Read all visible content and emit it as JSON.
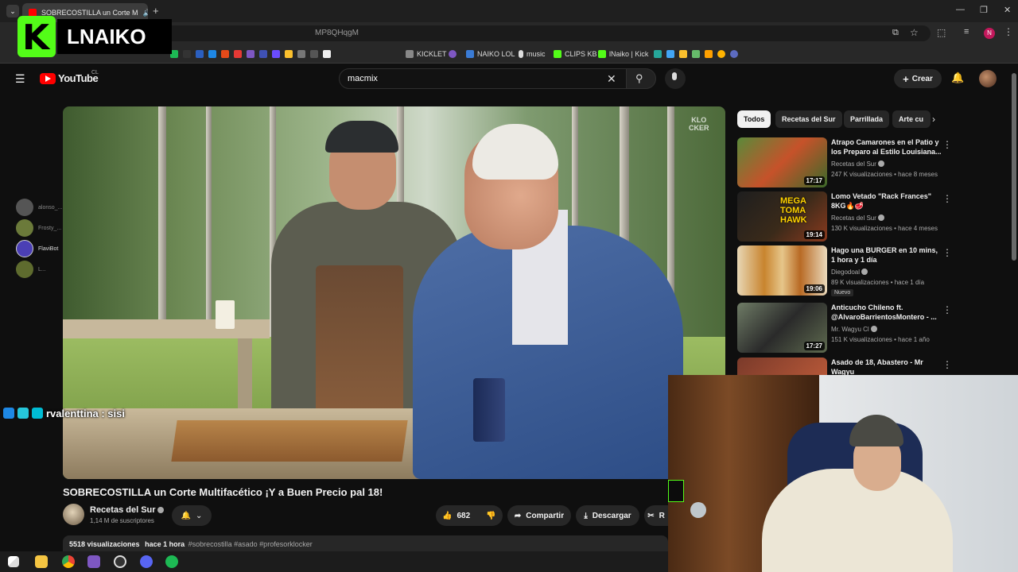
{
  "browser": {
    "tab_title": "SOBRECOSTILLA un Corte M",
    "url_fragment": "MP8QHqgM",
    "profile_initial": "N",
    "bookmarks": [
      {
        "label": "KICKLET",
        "color": "#888888"
      },
      {
        "label": "NAIKO LOL",
        "color": "#3a7bd5"
      },
      {
        "label": "music",
        "color": "#dddddd"
      },
      {
        "label": "CLIPS KB",
        "color": "#53fc18"
      },
      {
        "label": "lNaiko | Kick",
        "color": "#53fc18"
      }
    ]
  },
  "stream": {
    "logo_letter": "K",
    "streamer_name": "LNAIKO",
    "chat_message": "rvalenttina : sisi",
    "side_chat_users": [
      "alonso_...",
      "Frosty_...",
      "FlaviBot",
      "L..."
    ]
  },
  "youtube": {
    "logo_text": "YouTube",
    "country": "CL",
    "search_value": "macmix",
    "create_label": "Crear",
    "video": {
      "watermark_line1": "KLO",
      "watermark_line2": "CKER",
      "title": "SOBRECOSTILLA un Corte Multifacético ¡Y a Buen Precio pal 18!",
      "channel": "Recetas del Sur",
      "subscribers": "1,14 M de suscriptores",
      "likes": "682",
      "share_label": "Compartir",
      "download_label": "Descargar",
      "clip_label": "R",
      "views": "5518 visualizaciones",
      "time_ago": "hace 1 hora",
      "tags": "#sobrecostilla #asado #profesorklocker"
    },
    "chips": [
      "Todos",
      "Recetas del Sur",
      "Parrillada",
      "Arte cu"
    ],
    "recommendations": [
      {
        "title": "Atrapo Camarones en el Patio y los Preparo al Estilo Louisiana...",
        "channel": "Recetas del Sur",
        "meta": "247 K visualizaciones • hace 8 meses",
        "duration": "17:17",
        "badge": ""
      },
      {
        "title": "Lomo Vetado \"Rack Frances\" 8KG🔥🥩",
        "channel": "Recetas del Sur",
        "meta": "130 K visualizaciones • hace 4 meses",
        "duration": "19:14",
        "badge": "",
        "thumb_text": "MEGA TOMA HAWK"
      },
      {
        "title": "Hago una BURGER en 10 mins, 1 hora y 1 día",
        "channel": "Diegodoal",
        "meta": "89 K visualizaciones • hace 1 día",
        "duration": "19:06",
        "badge": "Nuevo"
      },
      {
        "title": "Anticucho Chileno ft. @AlvaroBarrientosMontero - ...",
        "channel": "Mr. Wagyu Cl",
        "meta": "151 K visualizaciones • hace 1 año",
        "duration": "17:27",
        "badge": ""
      },
      {
        "title": "Asado de 18, Abastero - Mr Wagyu",
        "channel": "",
        "meta": "",
        "duration": "",
        "badge": ""
      }
    ]
  },
  "colors": {
    "kick_green": "#53fc18",
    "yt_red": "#ff0000",
    "bg": "#0f0f0f"
  }
}
